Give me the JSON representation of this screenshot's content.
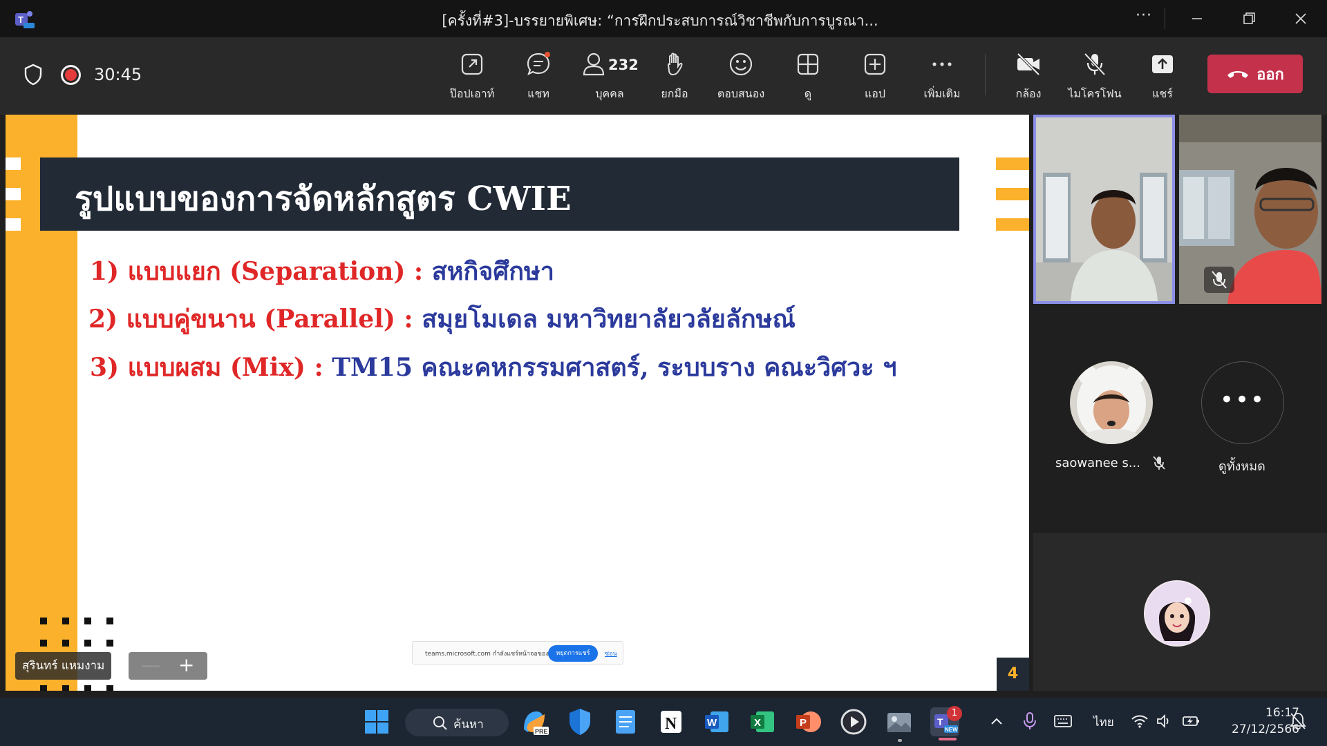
{
  "window": {
    "title": "[ครั้งที่#3]-บรรยายพิเศษ: “การฝึกประสบการณ์วิชาชีพกับการบูรณา...",
    "more": "···"
  },
  "toolbar": {
    "timer": "30:45",
    "popout": "ป๊อปเอาท์",
    "chat": "แชท",
    "people_count": "232",
    "people": "บุคคล",
    "raise": "ยกมือ",
    "react": "ตอบสนอง",
    "view": "ดู",
    "apps": "แอป",
    "more": "เพิ่มเติม",
    "camera": "กล้อง",
    "mic": "ไมโครโฟน",
    "share": "แชร์",
    "leave": "ออก"
  },
  "slide": {
    "title": "รูปแบบของการจัดหลักสูตร CWIE",
    "lines": [
      {
        "red": "1) แบบแยก (Separation) : ",
        "blue": "สหกิจศึกษา"
      },
      {
        "red": "2) แบบคู่ขนาน (Parallel) : ",
        "blue": "สมุยโมเดล มหาวิทยาลัยวลัยลักษณ์"
      },
      {
        "red": "3) แบบผสม (Mix) : ",
        "blue": "TM15 คณะคหกรรมศาสตร์, ระบบราง คณะวิศวะ ฯ"
      }
    ],
    "page": "4",
    "share_banner": {
      "text": "teams.microsoft.com กำลังแชร์หน้าจอของคุณ",
      "stop": "หยุดการแชร์",
      "hide": "ซ่อน"
    },
    "presenter": "สุรินทร์ แหมงาม",
    "zoom_out": "—",
    "zoom_in": "+"
  },
  "gallery": {
    "participant_name": "saowanee s...",
    "view_all": "ดูทั้งหมด",
    "more": "•••"
  },
  "taskbar": {
    "search": "ค้นหา",
    "language": "ไทย",
    "time": "16:17",
    "date": "27/12/2566",
    "teams_badge": "1"
  }
}
